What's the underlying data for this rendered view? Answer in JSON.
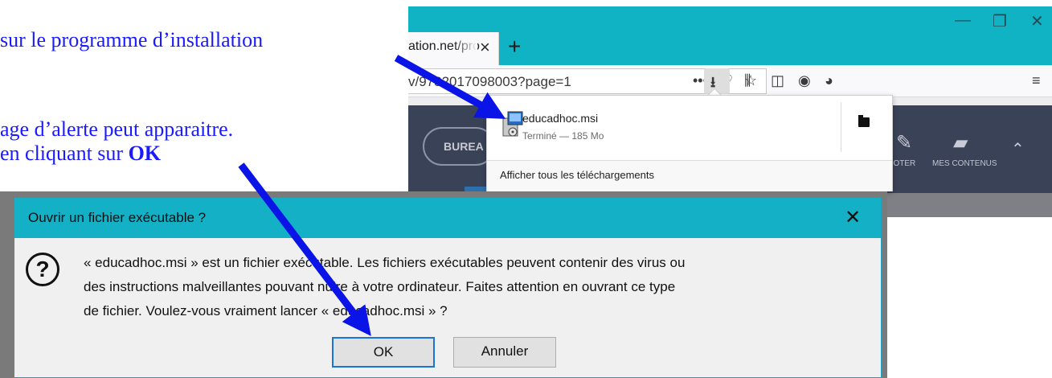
{
  "instructions": {
    "line1": "sur le programme d’installation",
    "line2": "age d’alerte peut apparaitre.",
    "line3_prefix": "en cliquant sur ",
    "line3_bold": "OK"
  },
  "browser": {
    "tab_title": "ation.net/pro",
    "tab_close": "×",
    "new_tab": "+",
    "window_controls": {
      "minimize": "—",
      "restore": "❐",
      "close": "✕"
    },
    "url": "v/9782017098003?page=1",
    "site": {
      "nav_button": "BUREA",
      "annotate_label": "NNOTER",
      "contents_label": "MES CONTENUS"
    }
  },
  "downloads": {
    "file_name": "educadhoc.msi",
    "status": "Terminé — 185 Mo",
    "show_all": "Afficher tous les téléchargements"
  },
  "dialog": {
    "title": "Ouvrir un fichier exécutable ?",
    "close": "✕",
    "line1": "« educadhoc.msi » est un fichier exécutable. Les fichiers exécutables peuvent contenir des virus ou",
    "line2": "des instructions malveillantes pouvant nuire à votre ordinateur. Faites attention en ouvrant ce type",
    "line3": "de fichier. Voulez-vous vraiment lancer « educadhoc.msi » ?",
    "ok_label": "OK",
    "cancel_label": "Annuler"
  },
  "colors": {
    "instruction_text": "#1a1aff",
    "arrow": "#0a14e6",
    "titlebar": "#10b3c3",
    "dialog_title": "#13b0c6"
  }
}
